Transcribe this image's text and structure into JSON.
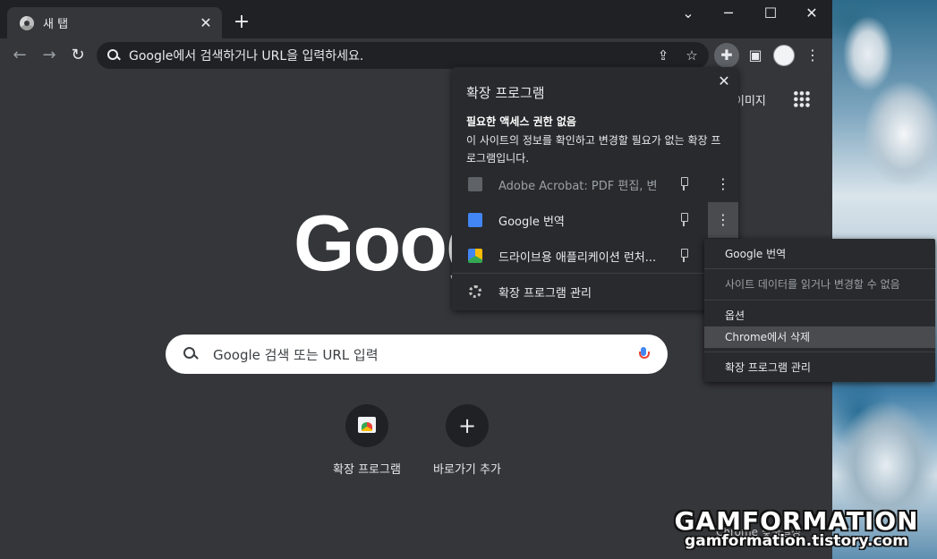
{
  "tab": {
    "title": "새 탭"
  },
  "window_controls": {
    "minimize": "─",
    "maximize": "☐",
    "close": "✕",
    "tablist": "⌄"
  },
  "toolbar": {
    "back": "←",
    "forward": "→",
    "reload": "↻",
    "omnibox_placeholder": "Google에서 검색하거나 URL을 입력하세요.",
    "share": "⇪",
    "bookmark": "☆",
    "extensions": "✚",
    "sidepanel": "▣",
    "menu": "⋮"
  },
  "ntp": {
    "images_link": "이미지",
    "logo": "Google",
    "search_placeholder": "Google 검색 또는 URL 입력",
    "shortcuts": [
      {
        "label": "확장 프로그램",
        "icon": "web-store-icon"
      },
      {
        "label": "바로가기 추가",
        "icon": "plus-icon",
        "glyph": "+"
      }
    ],
    "customize": "Chrome 맞춤설정"
  },
  "extensions_popup": {
    "title": "확장 프로그램",
    "close": "✕",
    "subhead": "필요한 액세스 권한 없음",
    "description": "이 사이트의 정보를 확인하고 변경할 필요가 없는 확장 프로그램입니다.",
    "items": [
      {
        "name": "Adobe Acrobat: PDF 편집, 변...",
        "icon": "adobe-acrobat-icon",
        "color": "#9aa0a6"
      },
      {
        "name": "Google 번역",
        "icon": "google-translate-icon",
        "color": "#4285f4"
      },
      {
        "name": "드라이브용 애플리케이션 런처...",
        "icon": "google-drive-icon",
        "color": "#34a853"
      }
    ],
    "more_glyph": "⋮",
    "manage": "확장 프로그램 관리"
  },
  "context_menu": {
    "items": [
      {
        "label": "Google 번역"
      },
      {
        "label": "사이트 데이터를 읽거나 변경할 수 없음"
      },
      {
        "label": "옵션"
      },
      {
        "label": "Chrome에서 삭제"
      },
      {
        "label": "확장 프로그램 관리"
      }
    ]
  },
  "watermark": {
    "brand": "GAMFORMATION",
    "url": "gamformation.tistory.com"
  }
}
